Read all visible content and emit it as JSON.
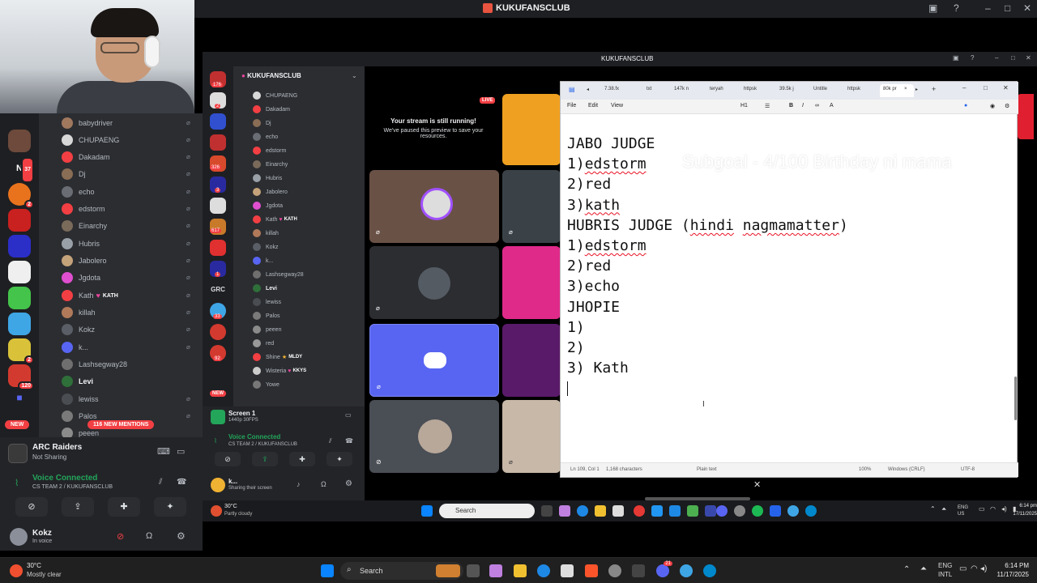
{
  "window": {
    "title": "KUKUFANSCLUB",
    "inner_title": "KUKUFANSCLUB"
  },
  "server_badges": [
    "37",
    "2",
    "2",
    "120",
    "176",
    "2",
    "326",
    "3",
    "617",
    "1",
    "33",
    "92"
  ],
  "server_letters": {
    "n": "N",
    "grc": "GRC"
  },
  "new_label": "NEW",
  "new_mentions": "116 NEW MENTIONS",
  "left_members": [
    "babydriver",
    "CHUPAENG",
    "Dakadam",
    "Dj",
    "echo",
    "edstorm",
    "Einarchy",
    "Hubris",
    "Jabolero",
    "Jgdota",
    "Kath",
    "killah",
    "Kokz",
    "k...",
    "Lashsegway28",
    "Levi",
    "lewiss",
    "Palos",
    "peeen"
  ],
  "kath_tag": "KATH",
  "activity": {
    "game": "ARC Raiders",
    "status": "Not Sharing"
  },
  "voice": {
    "label": "Voice Connected",
    "channel": "CS TEAM 2 / KUKUFANSCLUB"
  },
  "user": {
    "name": "Kokz",
    "status": "In voice"
  },
  "weather_left": {
    "temp": "30°C",
    "desc": "Mostly clear"
  },
  "d2": {
    "server_name": "KUKUFANSCLUB",
    "members": [
      "CHUPAENG",
      "Dakadam",
      "Dj",
      "echo",
      "edstorm",
      "Einarchy",
      "Hubris",
      "Jabolero",
      "Jgdota",
      "Kath",
      "killah",
      "Kokz",
      "k...",
      "Lashsegway28",
      "Levi",
      "lewiss",
      "Palos",
      "peeen",
      "red",
      "Shine",
      "Wisteria",
      "Yowe"
    ],
    "tags": {
      "kath": "KATH",
      "shine": "MLDY",
      "wisteria": "KKYS"
    },
    "screen": {
      "title": "Screen 1",
      "sub": "1440p 30FPS"
    },
    "voice": {
      "label": "Voice Connected",
      "channel": "CS TEAM 2 / KUKUFANSCLUB"
    },
    "user": {
      "name": "k...",
      "status": "Sharing their screen"
    },
    "weather": {
      "temp": "30°C",
      "desc": "Partly cloudy"
    },
    "search": "Search",
    "lang": "ENG\nUS",
    "time": "6:14 pm",
    "date": "17/11/2025"
  },
  "stream": {
    "live": "LIVE",
    "title": "Your stream is still running!",
    "sub": "We've paused this preview to save your resources."
  },
  "subgoal": "Subgoal - 4/100 Birthday ni mama",
  "notepad": {
    "tabs": [
      "7.38.fx",
      "txt",
      "147k n",
      "teryah",
      "httpsk",
      "39.5k j",
      "Untitle",
      "httpsk",
      "80k pr"
    ],
    "menu": [
      "File",
      "Edit",
      "View"
    ],
    "heading": "H1",
    "lines": [
      {
        "t": "JABO JUDGE"
      },
      {
        "p": "1)",
        "w": "edstorm"
      },
      {
        "t": "2)red"
      },
      {
        "p": "3)",
        "w": "kath"
      },
      {
        "t": ""
      },
      {
        "t": "HUBRIS JUDGE (",
        "w": "hindi",
        "m": " ",
        "w2": "nagmamatter",
        "e": ")"
      },
      {
        "p": "1)",
        "w": "edstorm"
      },
      {
        "t": "2)red"
      },
      {
        "t": "3)echo"
      },
      {
        "t": ""
      },
      {
        "t": "JHOPIE"
      },
      {
        "t": "1)"
      },
      {
        "t": "2)"
      },
      {
        "t": "3) Kath"
      }
    ],
    "status": {
      "pos": "Ln 109, Col 1",
      "chars": "1,168 characters",
      "type": "Plain text",
      "zoom": "100%",
      "eol": "Windows (CRLF)",
      "enc": "UTF-8"
    }
  },
  "taskbar": {
    "search": "Search",
    "lang1": "ENG",
    "lang2": "INTL",
    "time": "6:14 PM",
    "date": "11/17/2025",
    "notif": "21"
  }
}
